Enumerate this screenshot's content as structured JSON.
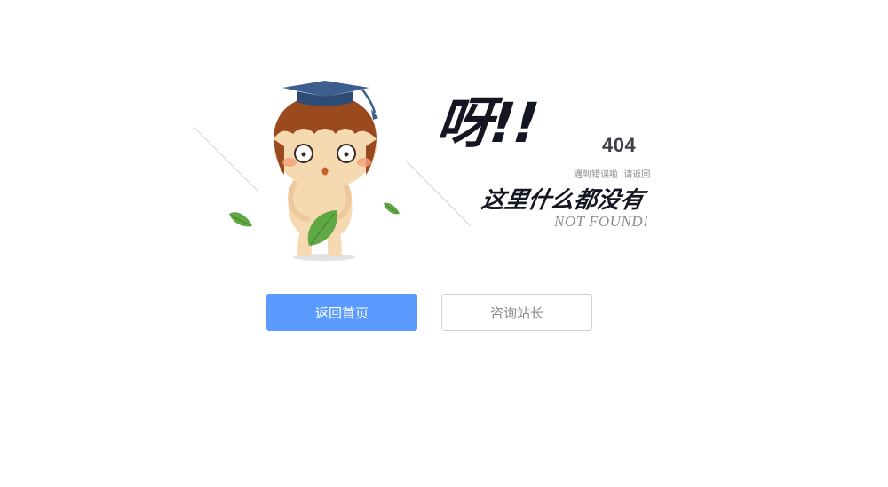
{
  "error": {
    "exclaim": "呀!!",
    "code": "404",
    "hint": "遇到错误啦 .请返回",
    "message": "这里什么都没有",
    "message_en": "NOT FOUND!"
  },
  "buttons": {
    "home_label": "返回首页",
    "contact_label": "咨询站长"
  },
  "colors": {
    "primary": "#5b9bff",
    "headline": "#141722",
    "muted": "#8a8a8a",
    "leaf": "#5fa843",
    "hair": "#9b4a1f",
    "cap": "#3d5f8e"
  },
  "icons": {
    "mascot": "cartoon-boy-holding-leaf-icon",
    "leaf": "leaf-icon"
  }
}
